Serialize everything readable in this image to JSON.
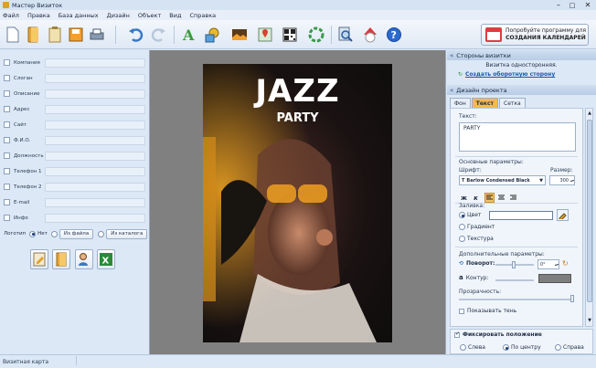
{
  "window": {
    "title": "Мастер Визиток"
  },
  "menu": [
    "Файл",
    "Правка",
    "База данных",
    "Дизайн",
    "Объект",
    "Вид",
    "Справка"
  ],
  "promo": {
    "line1": "Попробуйте программу для",
    "line2": "СОЗДАНИЯ КАЛЕНДАРЕЙ"
  },
  "fields": [
    "Компания",
    "Слоган",
    "Описание",
    "Адрес",
    "Сайт",
    "Ф.И.О.",
    "Должность",
    "Телефон 1",
    "Телефон 2",
    "E-mail",
    "Инфо"
  ],
  "logo": {
    "label": "Логотип",
    "none": "Нет",
    "from_file": "Из файла",
    "from_catalog": "Из каталога"
  },
  "card": {
    "title": "JAZZ",
    "subtitle": "PARTY"
  },
  "sides": {
    "header": "Стороны визитки",
    "info": "Визитка односторонняя.",
    "link": "Создать оборотную сторону"
  },
  "design": {
    "header": "Дизайн проекта",
    "tabs": [
      "Фон",
      "Текст",
      "Сетка"
    ],
    "active_tab": "Текст",
    "text_label": "Текст:",
    "text_value": "PARTY",
    "basic_params": "Основные параметры:",
    "font_label": "Шрифт:",
    "font_value": "Barlow Condensed Black",
    "size_label": "Размер:",
    "size_value": "300",
    "fill_label": "Заливка:",
    "fill_color": "Цвет",
    "fill_gradient": "Градиент",
    "fill_texture": "Текстура",
    "extra_params": "Дополнительные параметры:",
    "rotation_label": "Поворот:",
    "rotation_value": "0°",
    "outline_label": "Контур:",
    "opacity_label": "Прозрачность:",
    "shadow_label": "Показывать тень"
  },
  "position": {
    "fix_label": "Фиксировать положение",
    "left": "Слева",
    "center": "По центру",
    "right": "Справа"
  },
  "status": {
    "text": "Визитная карта"
  },
  "colors": {
    "accent": "#f5b94a",
    "link": "#1a56b0",
    "toolbar": "#dfe9f5"
  }
}
